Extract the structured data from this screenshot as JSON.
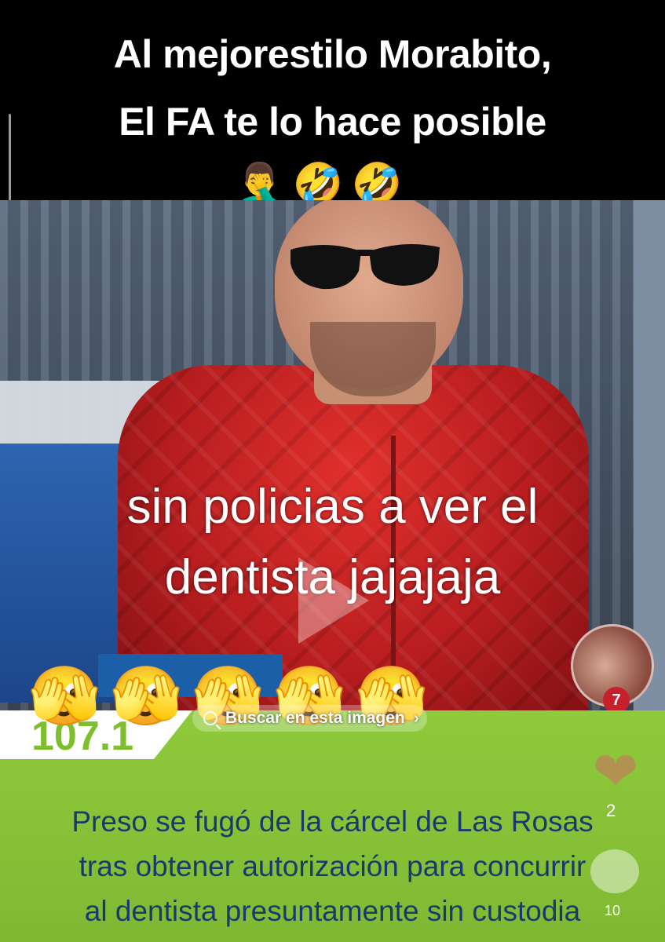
{
  "overlay_title": {
    "line1": "Al mejorestilo Morabito,",
    "line2": "El FA te lo hace posible",
    "emojis": [
      "🤦‍♂️",
      "🤣",
      "🤣"
    ]
  },
  "video_caption": {
    "line1": "sin policias a ver el",
    "line2": "dentista jajajaja"
  },
  "station_frequency": "107.1",
  "search_pill": {
    "label": "Buscar en esta imagen",
    "chevron": "›"
  },
  "reaction_faces": [
    "🫣",
    "🫣",
    "🫣",
    "🫣",
    "🫣"
  ],
  "side_actions": {
    "heart_glyph": "❤",
    "like_count": "2",
    "comment_count": "10",
    "avatar_badge": "7"
  },
  "news_headline": {
    "line1": "Preso se fugó de la cárcel de Las Rosas",
    "line2": "tras obtener autorización para concurrir",
    "line3": "al dentista presuntamente sin custodia"
  },
  "colors": {
    "banner_green": "#8fca3c",
    "headline_text": "#1a3a6f",
    "jacket_red": "#c9221f"
  }
}
